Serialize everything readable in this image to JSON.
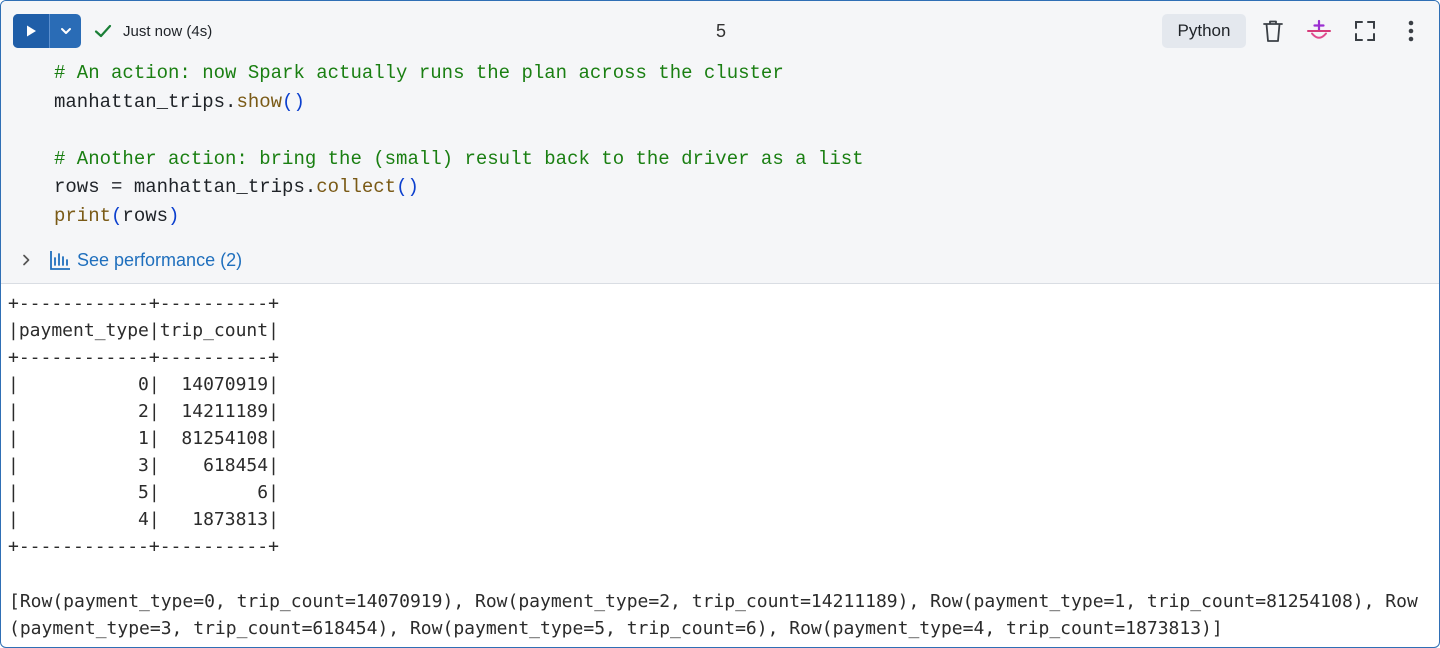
{
  "header": {
    "status": "Just now (4s)",
    "cell_number": "5",
    "language": "Python"
  },
  "icons": {
    "run": "play-icon",
    "dropdown": "chevron-down-icon",
    "status": "check-icon",
    "delete": "trash-icon",
    "assistant": "assistant-sparkle-icon",
    "fullscreen": "expand-icon",
    "more": "more-vertical-icon",
    "performance": "bar-chart-icon",
    "expander": "chevron-right-icon"
  },
  "colors": {
    "accent": "#1f5ea8",
    "link": "#1f6fbd",
    "comment": "#1a7f12",
    "function": "#7a5a16",
    "paren": "#0b3fce",
    "success": "#1a7f37"
  },
  "code": {
    "lines": [
      {
        "comment": "# An action: now Spark actually runs the plan across the cluster"
      },
      {
        "pre": "manhattan_trips.",
        "fn": "show",
        "open": "(",
        "args": "",
        "close": ")"
      },
      {},
      {
        "comment": "# Another action: bring the (small) result back to the driver as a list"
      },
      {
        "pre": "rows = manhattan_trips.",
        "fn": "collect",
        "open": "(",
        "args": "",
        "close": ")"
      },
      {
        "pre": "",
        "fn": "print",
        "open": "(",
        "args": "rows",
        "close": ")"
      }
    ]
  },
  "performance": {
    "label": "See performance (2)"
  },
  "output": {
    "table_lines": [
      "+------------+----------+",
      "|payment_type|trip_count|",
      "+------------+----------+",
      "|           0|  14070919|",
      "|           2|  14211189|",
      "|           1|  81254108|",
      "|           3|    618454|",
      "|           5|         6|",
      "|           4|   1873813|",
      "+------------+----------+"
    ],
    "rows_text": "[Row(payment_type=0, trip_count=14070919), Row(payment_type=2, trip_count=14211189), Row(payment_type=1, trip_count=81254108), Row(payment_type=3, trip_count=618454), Row(payment_type=5, trip_count=6), Row(payment_type=4, trip_count=1873813)]"
  }
}
